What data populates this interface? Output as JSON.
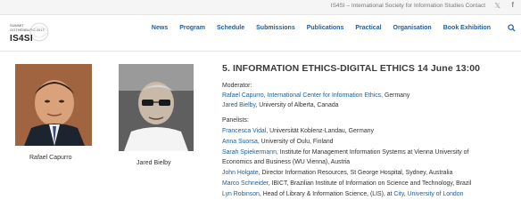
{
  "topbar": {
    "society_text": "IS4SI – International Society for Information Studies",
    "contact": "Contact",
    "twitter_icon": "twitter-icon",
    "facebook_icon": "facebook-icon"
  },
  "logo": {
    "caption_line1": "SUMMIT",
    "caption_line2": "GOTHENBURG 2017",
    "wordmark": "IS4SI"
  },
  "nav": {
    "items": [
      "News",
      "Program",
      "Schedule",
      "Submissions",
      "Publications",
      "Practical",
      "Organisation",
      "Book Exhibition"
    ],
    "search_icon": "search-icon",
    "active_color": "#1f5d9a"
  },
  "session": {
    "title": "5. INFORMATION ETHICS-DIGITAL ETHICS 14 June 13:00",
    "moderator_label": "Moderator:",
    "moderators": [
      {
        "name": "Rafael Capurro",
        "sep": ", ",
        "affil_link": "International Center for Information Ethics",
        "rest": ", Germany"
      },
      {
        "name": "Jared Bielby",
        "sep": ", University of Alberta, Canada",
        "affil_link": "",
        "rest": ""
      }
    ],
    "panelists_label": "Panelists:",
    "panelists": [
      {
        "name": "Francesca Vidal",
        "text": ", Universität Koblenz-Landau, Germany"
      },
      {
        "name": "Anna Suorsa",
        "text": ", University of Oulu, Finland"
      },
      {
        "name": "Sarah Spiekermann",
        "text": ",  Institute for Management Information Systems at Vienna University of"
      },
      {
        "name": "",
        "text": "Economics and Business (WU Vienna), Austria"
      },
      {
        "name": "John Holgate",
        "text": ", Director Information Resources, St George Hospital, Sydney, Australia"
      },
      {
        "name": "Marco Schneider",
        "text": ", IBICT, Brazilian Institute of Information on Science and Technology, Brazil"
      },
      {
        "name": "Lyn Robinson",
        "text": ", Head of Library & Information Science, (LIS), at ",
        "link2": "City, University of London"
      }
    ]
  },
  "people": [
    {
      "name": "Rafael Capurro"
    },
    {
      "name": "Jared Bielby"
    }
  ]
}
